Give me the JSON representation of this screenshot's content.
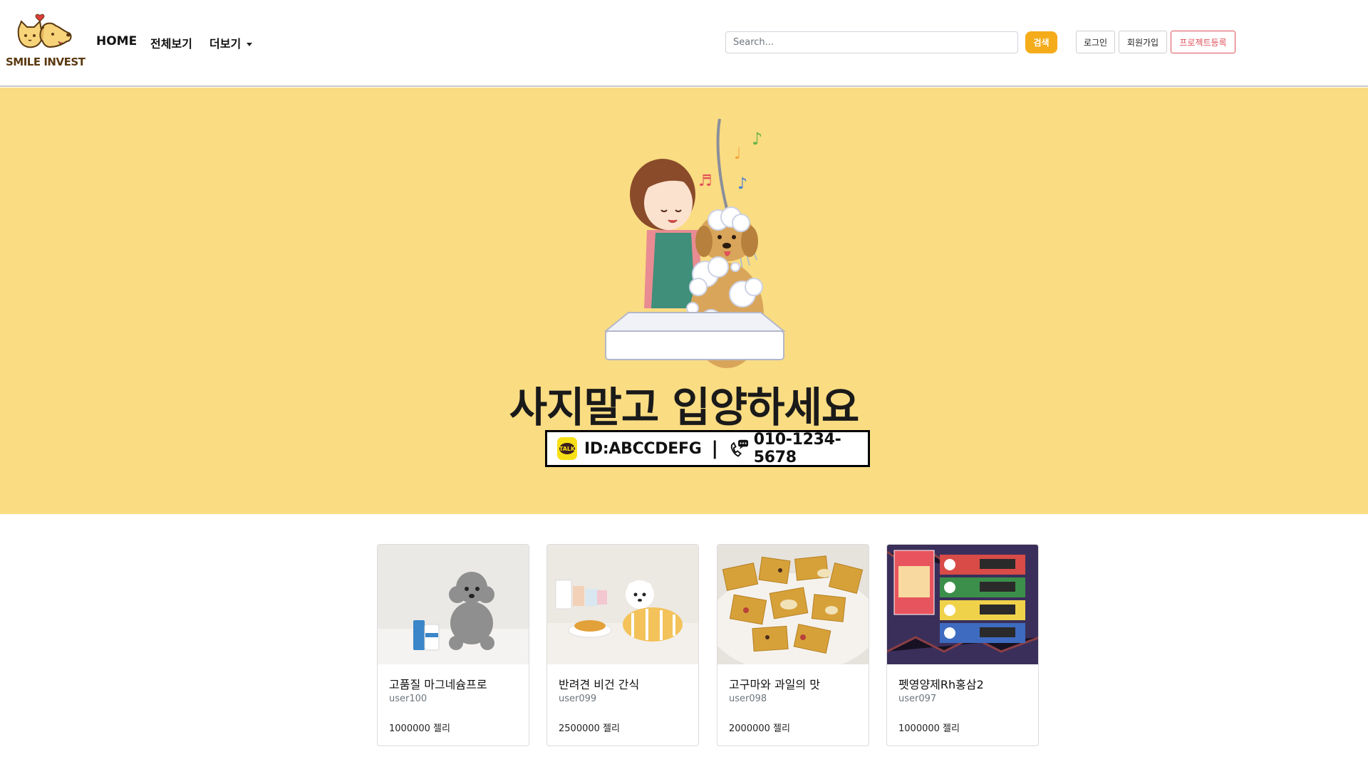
{
  "brand": {
    "name": "SMILE INVEST"
  },
  "nav": {
    "home": "HOME",
    "all": "전체보기",
    "more": "더보기"
  },
  "search": {
    "placeholder": "Search...",
    "button": "검색"
  },
  "auth": {
    "login": "로그인",
    "signup": "회원가입",
    "register_project": "프로젝트등록"
  },
  "hero": {
    "slogan": "사지말고 입양하세요",
    "contact_id": "ID:ABCCDEFG",
    "separator": "|",
    "phone": "010-1234-5678",
    "talk_badge": "TALK"
  },
  "products": [
    {
      "title": "고품질 마그네슘프로",
      "user": "user100",
      "price": "1000000 젤리"
    },
    {
      "title": "반려견 비건 간식",
      "user": "user099",
      "price": "2500000 젤리"
    },
    {
      "title": "고구마와 과일의 맛",
      "user": "user098",
      "price": "2000000 젤리"
    },
    {
      "title": "펫영양제Rh홍삼2",
      "user": "user097",
      "price": "1000000 젤리"
    }
  ],
  "colors": {
    "hero_bg": "#fadc82",
    "search_button": "#f5ac1b",
    "register_accent": "#e0525a"
  }
}
